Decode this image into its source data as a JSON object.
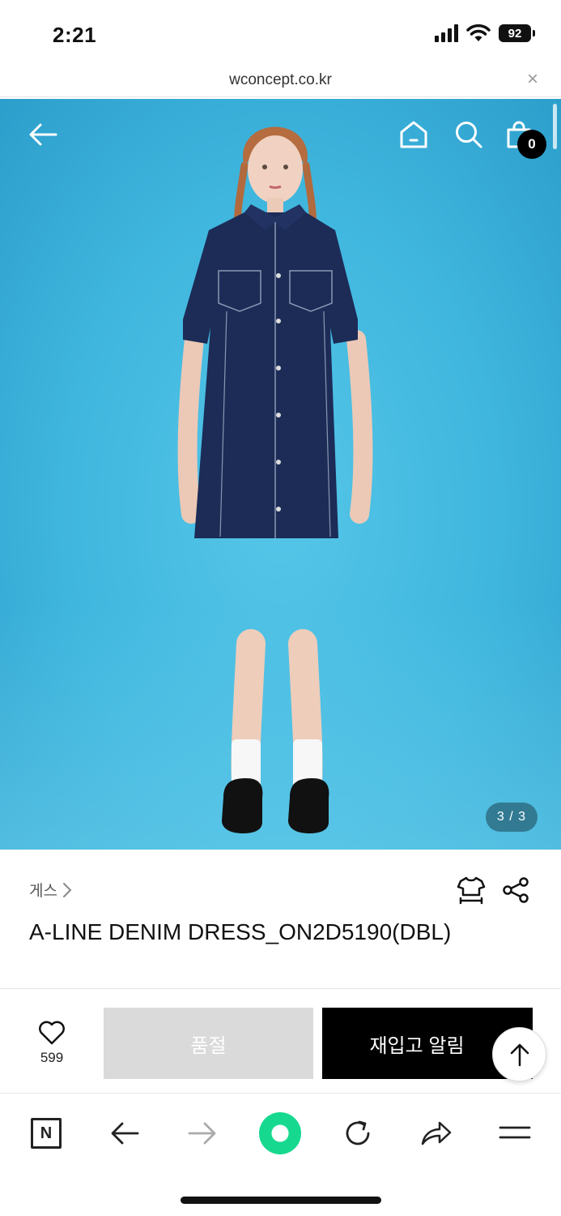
{
  "status_bar": {
    "time": "2:21",
    "battery": "92"
  },
  "browser": {
    "url": "wconcept.co.kr",
    "close_label": "×"
  },
  "header": {
    "cart_count": "0"
  },
  "gallery": {
    "pager": "3 / 3"
  },
  "product": {
    "brand": "게스",
    "name": "A-LINE DENIM DRESS_ON2D5190(DBL)"
  },
  "actions": {
    "like_count": "599",
    "soldout_label": "품절",
    "restock_label": "재입고 알림"
  },
  "colors": {
    "hero_background": "#3fb6de",
    "primary_button": "#000000",
    "disabled_button": "#dadada",
    "browser_green": "#16d98f"
  }
}
